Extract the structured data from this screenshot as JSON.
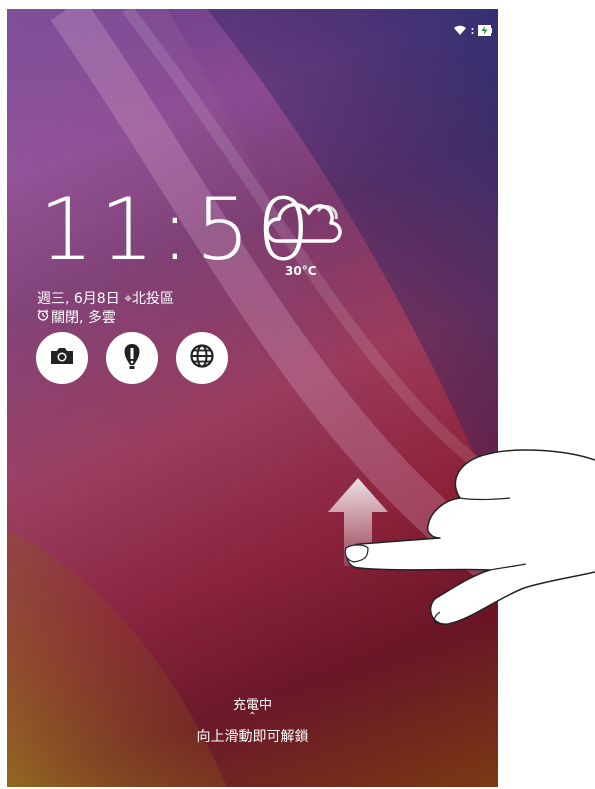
{
  "status_bar": {
    "wifi_icon": "wifi-icon",
    "battery_icon": "battery-charging-icon"
  },
  "lock_screen": {
    "time": "11:50",
    "temperature": "30°C",
    "date_location": "週三, 6月8日 ⌖北投區",
    "alarm_weather": "關閉, 多雲",
    "shortcuts": [
      {
        "name": "camera",
        "icon": "camera-icon"
      },
      {
        "name": "flashlight",
        "icon": "flashlight-icon"
      },
      {
        "name": "browser",
        "icon": "globe-icon"
      }
    ],
    "charging_text": "充電中",
    "unlock_chevron": "⌃",
    "unlock_hint": "向上滑動即可解鎖"
  },
  "colors": {
    "text": "#ffffff",
    "button_bg": "#ffffff",
    "icon": "#222222"
  }
}
